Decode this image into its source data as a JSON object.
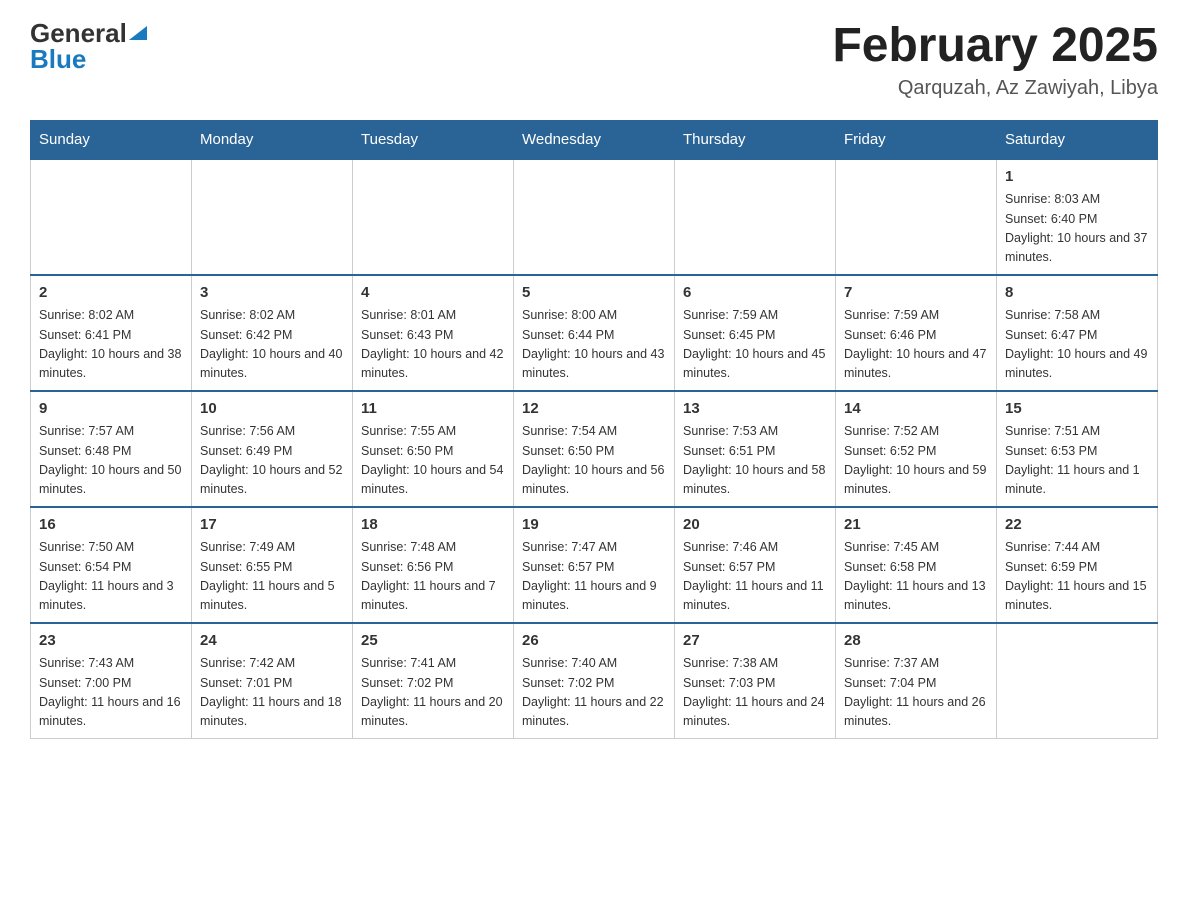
{
  "header": {
    "logo_general": "General",
    "logo_blue": "Blue",
    "month_title": "February 2025",
    "location": "Qarquzah, Az Zawiyah, Libya"
  },
  "weekdays": [
    "Sunday",
    "Monday",
    "Tuesday",
    "Wednesday",
    "Thursday",
    "Friday",
    "Saturday"
  ],
  "weeks": [
    [
      {
        "day": "",
        "sunrise": "",
        "sunset": "",
        "daylight": ""
      },
      {
        "day": "",
        "sunrise": "",
        "sunset": "",
        "daylight": ""
      },
      {
        "day": "",
        "sunrise": "",
        "sunset": "",
        "daylight": ""
      },
      {
        "day": "",
        "sunrise": "",
        "sunset": "",
        "daylight": ""
      },
      {
        "day": "",
        "sunrise": "",
        "sunset": "",
        "daylight": ""
      },
      {
        "day": "",
        "sunrise": "",
        "sunset": "",
        "daylight": ""
      },
      {
        "day": "1",
        "sunrise": "Sunrise: 8:03 AM",
        "sunset": "Sunset: 6:40 PM",
        "daylight": "Daylight: 10 hours and 37 minutes."
      }
    ],
    [
      {
        "day": "2",
        "sunrise": "Sunrise: 8:02 AM",
        "sunset": "Sunset: 6:41 PM",
        "daylight": "Daylight: 10 hours and 38 minutes."
      },
      {
        "day": "3",
        "sunrise": "Sunrise: 8:02 AM",
        "sunset": "Sunset: 6:42 PM",
        "daylight": "Daylight: 10 hours and 40 minutes."
      },
      {
        "day": "4",
        "sunrise": "Sunrise: 8:01 AM",
        "sunset": "Sunset: 6:43 PM",
        "daylight": "Daylight: 10 hours and 42 minutes."
      },
      {
        "day": "5",
        "sunrise": "Sunrise: 8:00 AM",
        "sunset": "Sunset: 6:44 PM",
        "daylight": "Daylight: 10 hours and 43 minutes."
      },
      {
        "day": "6",
        "sunrise": "Sunrise: 7:59 AM",
        "sunset": "Sunset: 6:45 PM",
        "daylight": "Daylight: 10 hours and 45 minutes."
      },
      {
        "day": "7",
        "sunrise": "Sunrise: 7:59 AM",
        "sunset": "Sunset: 6:46 PM",
        "daylight": "Daylight: 10 hours and 47 minutes."
      },
      {
        "day": "8",
        "sunrise": "Sunrise: 7:58 AM",
        "sunset": "Sunset: 6:47 PM",
        "daylight": "Daylight: 10 hours and 49 minutes."
      }
    ],
    [
      {
        "day": "9",
        "sunrise": "Sunrise: 7:57 AM",
        "sunset": "Sunset: 6:48 PM",
        "daylight": "Daylight: 10 hours and 50 minutes."
      },
      {
        "day": "10",
        "sunrise": "Sunrise: 7:56 AM",
        "sunset": "Sunset: 6:49 PM",
        "daylight": "Daylight: 10 hours and 52 minutes."
      },
      {
        "day": "11",
        "sunrise": "Sunrise: 7:55 AM",
        "sunset": "Sunset: 6:50 PM",
        "daylight": "Daylight: 10 hours and 54 minutes."
      },
      {
        "day": "12",
        "sunrise": "Sunrise: 7:54 AM",
        "sunset": "Sunset: 6:50 PM",
        "daylight": "Daylight: 10 hours and 56 minutes."
      },
      {
        "day": "13",
        "sunrise": "Sunrise: 7:53 AM",
        "sunset": "Sunset: 6:51 PM",
        "daylight": "Daylight: 10 hours and 58 minutes."
      },
      {
        "day": "14",
        "sunrise": "Sunrise: 7:52 AM",
        "sunset": "Sunset: 6:52 PM",
        "daylight": "Daylight: 10 hours and 59 minutes."
      },
      {
        "day": "15",
        "sunrise": "Sunrise: 7:51 AM",
        "sunset": "Sunset: 6:53 PM",
        "daylight": "Daylight: 11 hours and 1 minute."
      }
    ],
    [
      {
        "day": "16",
        "sunrise": "Sunrise: 7:50 AM",
        "sunset": "Sunset: 6:54 PM",
        "daylight": "Daylight: 11 hours and 3 minutes."
      },
      {
        "day": "17",
        "sunrise": "Sunrise: 7:49 AM",
        "sunset": "Sunset: 6:55 PM",
        "daylight": "Daylight: 11 hours and 5 minutes."
      },
      {
        "day": "18",
        "sunrise": "Sunrise: 7:48 AM",
        "sunset": "Sunset: 6:56 PM",
        "daylight": "Daylight: 11 hours and 7 minutes."
      },
      {
        "day": "19",
        "sunrise": "Sunrise: 7:47 AM",
        "sunset": "Sunset: 6:57 PM",
        "daylight": "Daylight: 11 hours and 9 minutes."
      },
      {
        "day": "20",
        "sunrise": "Sunrise: 7:46 AM",
        "sunset": "Sunset: 6:57 PM",
        "daylight": "Daylight: 11 hours and 11 minutes."
      },
      {
        "day": "21",
        "sunrise": "Sunrise: 7:45 AM",
        "sunset": "Sunset: 6:58 PM",
        "daylight": "Daylight: 11 hours and 13 minutes."
      },
      {
        "day": "22",
        "sunrise": "Sunrise: 7:44 AM",
        "sunset": "Sunset: 6:59 PM",
        "daylight": "Daylight: 11 hours and 15 minutes."
      }
    ],
    [
      {
        "day": "23",
        "sunrise": "Sunrise: 7:43 AM",
        "sunset": "Sunset: 7:00 PM",
        "daylight": "Daylight: 11 hours and 16 minutes."
      },
      {
        "day": "24",
        "sunrise": "Sunrise: 7:42 AM",
        "sunset": "Sunset: 7:01 PM",
        "daylight": "Daylight: 11 hours and 18 minutes."
      },
      {
        "day": "25",
        "sunrise": "Sunrise: 7:41 AM",
        "sunset": "Sunset: 7:02 PM",
        "daylight": "Daylight: 11 hours and 20 minutes."
      },
      {
        "day": "26",
        "sunrise": "Sunrise: 7:40 AM",
        "sunset": "Sunset: 7:02 PM",
        "daylight": "Daylight: 11 hours and 22 minutes."
      },
      {
        "day": "27",
        "sunrise": "Sunrise: 7:38 AM",
        "sunset": "Sunset: 7:03 PM",
        "daylight": "Daylight: 11 hours and 24 minutes."
      },
      {
        "day": "28",
        "sunrise": "Sunrise: 7:37 AM",
        "sunset": "Sunset: 7:04 PM",
        "daylight": "Daylight: 11 hours and 26 minutes."
      },
      {
        "day": "",
        "sunrise": "",
        "sunset": "",
        "daylight": ""
      }
    ]
  ]
}
